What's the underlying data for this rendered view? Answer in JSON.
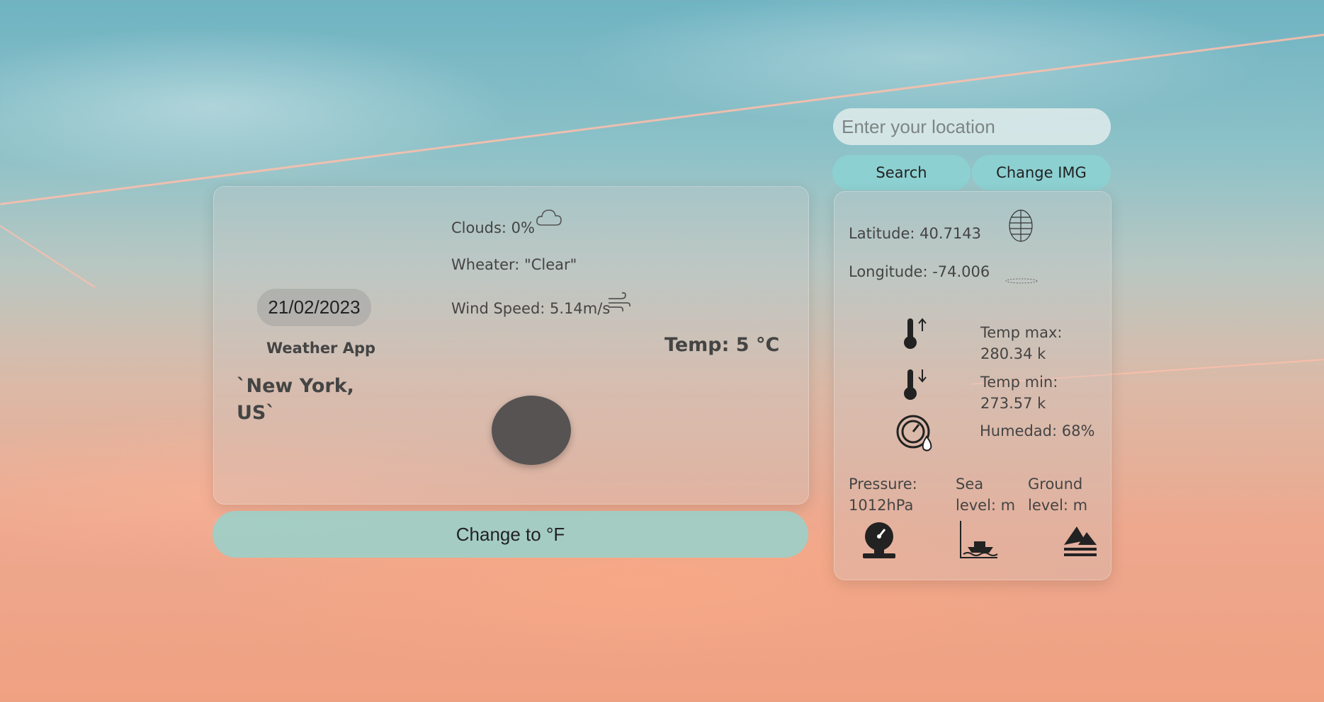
{
  "main_card": {
    "date": "21/02/2023",
    "app_name": "Weather App",
    "city": "`New York, US`",
    "clouds": "Clouds: 0%",
    "weather": "Wheater: \"Clear\"",
    "wind": "Wind Speed: 5.14m/s",
    "temp": "Temp: 5 °C"
  },
  "convert_button": "Change to °F",
  "search": {
    "placeholder": "Enter your location",
    "search_label": "Search",
    "change_img_label": "Change IMG"
  },
  "details": {
    "latitude": "Latitude: 40.7143",
    "longitude": "Longitude: -74.006",
    "temp_max": "Temp max: 280.34 k",
    "temp_min": "Temp min: 273.57 k",
    "humidity": "Humedad: 68%",
    "pressure": "Pressure: 1012hPa",
    "sea_level": "Sea level: m",
    "ground_level": "Ground level: m"
  },
  "icons": {
    "clouds": "cloud-icon",
    "wind": "wind-icon",
    "weather": "weather-icon",
    "globe": "globe-icon",
    "temp_max": "thermometer-up-icon",
    "temp_min": "thermometer-down-icon",
    "humidity": "humidity-gauge-icon",
    "pressure": "barometer-icon",
    "sea_level": "sea-level-icon",
    "ground_level": "mountain-icon"
  },
  "colors": {
    "button": "#8cd2d2",
    "weather_circle": "#575353"
  }
}
